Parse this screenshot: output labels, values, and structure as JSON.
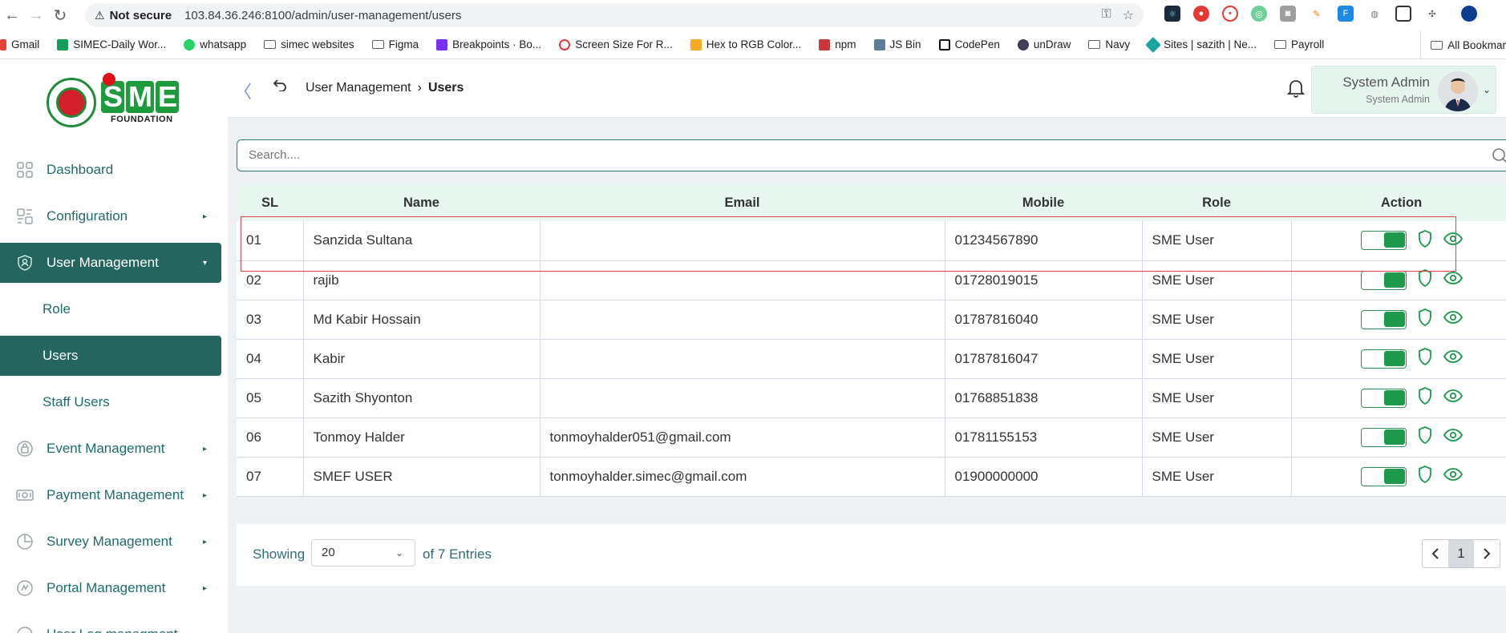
{
  "browser": {
    "security_label": "Not secure",
    "url": "103.84.36.246:8100/admin/user-management/users",
    "bookmarks": [
      "Gmail",
      "SIMEC-Daily Wor...",
      "whatsapp",
      "simec websites",
      "Figma",
      "Breakpoints · Bo...",
      "Screen Size For R...",
      "Hex to RGB Color...",
      "npm",
      "JS Bin",
      "CodePen",
      "unDraw",
      "Navy",
      "Sites | sazith | Ne...",
      "Payroll"
    ],
    "all_bookmarks": "All Bookmar"
  },
  "logo": {
    "foundation": "FOUNDATION"
  },
  "sidebar": {
    "items": [
      {
        "label": "Dashboard"
      },
      {
        "label": "Configuration"
      },
      {
        "label": "User Management"
      },
      {
        "label": "Event Management"
      },
      {
        "label": "Payment Management"
      },
      {
        "label": "Survey Management"
      },
      {
        "label": "Portal Management"
      },
      {
        "label": "User Log managment"
      }
    ],
    "sub_items": [
      {
        "label": "Role"
      },
      {
        "label": "Users"
      },
      {
        "label": "Staff Users"
      }
    ]
  },
  "header": {
    "breadcrumb_parent": "User Management",
    "breadcrumb_current": "Users",
    "user_name": "System Admin",
    "user_role": "System Admin"
  },
  "search": {
    "placeholder": "Search...."
  },
  "table": {
    "columns": [
      "SL",
      "Name",
      "Email",
      "Mobile",
      "Role",
      "Action"
    ],
    "rows": [
      {
        "sl": "01",
        "name": "Sanzida Sultana",
        "email": "",
        "mobile": "01234567890",
        "role": "SME User"
      },
      {
        "sl": "02",
        "name": "rajib",
        "email": "",
        "mobile": "01728019015",
        "role": "SME User"
      },
      {
        "sl": "03",
        "name": "Md Kabir Hossain",
        "email": "",
        "mobile": "01787816040",
        "role": "SME User"
      },
      {
        "sl": "04",
        "name": "Kabir",
        "email": "",
        "mobile": "01787816047",
        "role": "SME User"
      },
      {
        "sl": "05",
        "name": "Sazith Shyonton",
        "email": "",
        "mobile": "01768851838",
        "role": "SME User"
      },
      {
        "sl": "06",
        "name": "Tonmoy Halder",
        "email": "tonmoyhalder051@gmail.com",
        "mobile": "01781155153",
        "role": "SME User"
      },
      {
        "sl": "07",
        "name": "SMEF USER",
        "email": "tonmoyhalder.simec@gmail.com",
        "mobile": "01900000000",
        "role": "SME User"
      }
    ]
  },
  "pagination": {
    "showing": "Showing",
    "page_size": "20",
    "entries": "of 7 Entries",
    "current_page": "1"
  },
  "colors": {
    "primary": "#24665f",
    "accent_green": "#1f9a4c",
    "header_bg": "#e7f6ee",
    "highlight": "#e04545"
  }
}
